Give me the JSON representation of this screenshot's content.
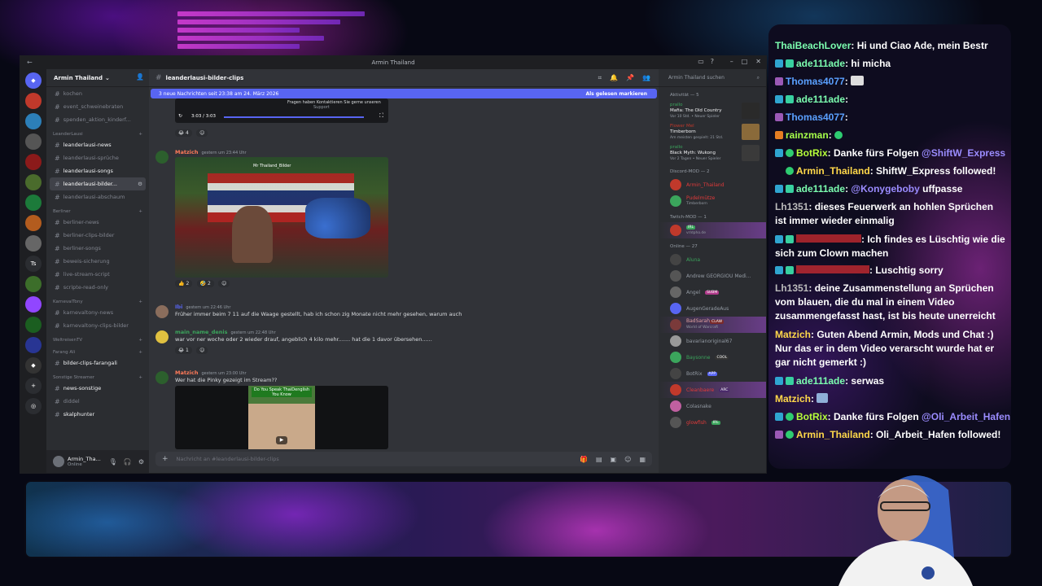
{
  "window": {
    "title": "Armin Thailand"
  },
  "server": {
    "name": "Armin Thailand"
  },
  "channels": {
    "top": [
      "kochen",
      "event_schweinebraten",
      "spenden_aktion_kinderf..."
    ],
    "cat_leander": "LeanderLausi",
    "leander": [
      "leanderlausi-news",
      "leanderlausi-sprüche",
      "leanderlausi-songs",
      "leanderlausi-bilder...",
      "leanderlausi-abschaum"
    ],
    "cat_berliner": "Berliner",
    "berliner": [
      "berliner-news",
      "berliner-clips-bilder",
      "berliner-songs",
      "beweis-sicherung",
      "live-stream-script",
      "scripte-read-only"
    ],
    "cat_karneval": "KarnevalTony",
    "karneval": [
      "karnevaltony-news",
      "karnevaltony-clips-bilder"
    ],
    "cat_weltreisen": "WeltreisenTV",
    "cat_farang": "Farang Ali",
    "farang": [
      "bilder-clips-farangali"
    ],
    "cat_sonstige": "Sonstige Streamer",
    "sonstige": [
      "news-sonstige",
      "diddel",
      "skalphunter"
    ]
  },
  "user": {
    "name": "Armin_Tha...",
    "status": "Online"
  },
  "channel_header": {
    "name": "leanderlausi-bilder-clips"
  },
  "new_messages_bar": {
    "text": "3 neue Nachrichten seit 23:38 am 24. März 2026",
    "action": "Als gelesen markieren"
  },
  "video_player": {
    "time": "3:03 / 3:03",
    "caption1": "Fragen haben Kontaktieren Sie gerne unseren",
    "caption2": "Support"
  },
  "messages": [
    {
      "author": "Matzich",
      "time": "gestern um 23:44 Uhr",
      "text": "",
      "reactions": [
        "2",
        "2"
      ],
      "video_label": "Mr Thailand_Bilder"
    },
    {
      "author": "Ibi",
      "time": "gestern um 22:46 Uhr",
      "text": "Früher immer beim 7 11 auf die Waage gestellt, hab ich schon zig Monate nicht mehr gesehen, warum auch"
    },
    {
      "author": "main_name_denis",
      "time": "gestern um 22:48 Uhr",
      "text": "war vor ner woche oder 2 wieder drauf, angeblich 4 kilo mehr....... hat die 1 davor übersehen......",
      "reactions": [
        "1"
      ]
    },
    {
      "author": "Matzich",
      "time": "gestern um 23:00 Uhr",
      "text": "Wer hat die Pinky gezeigt im Stream??",
      "video_label": "Do You Speak ThaiDenglish You Know"
    }
  ],
  "top_reaction_count": "4",
  "composer": {
    "placeholder": "Nachricht an #leanderlausi-bilder-clips"
  },
  "members": {
    "search": "Armin Thailand suchen",
    "activity_header": "Aktivität — 5",
    "activities": [
      {
        "user": "prallo",
        "game": "Mafia: The Old Country",
        "meta": "Vor 10 Std. • Neuer Spieler"
      },
      {
        "user": "Flower Mel",
        "game": "Timberborn",
        "meta": "Am meisten gespielt: 21 Std."
      },
      {
        "user": "prallo",
        "game": "Black Myth: Wukong",
        "meta": "Vor 2 Tagen • Neuer Spieler"
      }
    ],
    "discord_mod_header": "Discord-MOD — 2",
    "discord_mods": [
      {
        "name": "Armin_Thailand",
        "sub": ""
      },
      {
        "name": "Pudelmütze",
        "sub": "Timberborn"
      }
    ],
    "twitch_mod_header": "Twitch-MOD — 1",
    "twitch_mods": [
      {
        "name": "",
        "sub": "vrldpho.de"
      }
    ],
    "online_header": "Online — 27",
    "online": [
      {
        "name": "Aluna",
        "badge": ""
      },
      {
        "name": "Andrew GEORGIOU Medi...",
        "badge": ""
      },
      {
        "name": "Angel",
        "badge": "SUBM"
      },
      {
        "name": "AugenGeradeAus",
        "badge": ""
      },
      {
        "name": "BadSarah",
        "badge": "CLAW",
        "sub": "World of Warcraft"
      },
      {
        "name": "bavarianoriginal67",
        "badge": ""
      },
      {
        "name": "Baysonne",
        "badge": "COOL"
      },
      {
        "name": "BotRix",
        "badge": "APP"
      },
      {
        "name": "Cleanbaere",
        "badge": "ARC"
      },
      {
        "name": "Colasnake",
        "badge": ""
      },
      {
        "name": "glowfish",
        "badge": "IRL"
      }
    ]
  },
  "chat": [
    {
      "user": "ThaiBeachLover",
      "msg": ": Hi und Ciao Ade, mein Bestr",
      "ucolor": "#7cffb0"
    },
    {
      "user": "ade111ade",
      "msg": ": hi micha",
      "ucolor": "#7cffb0"
    },
    {
      "user": "Thomas4077",
      "msg": ":",
      "ucolor": "#5aa0ff"
    },
    {
      "user": "ade111ade",
      "msg": ":",
      "ucolor": "#7cffb0"
    },
    {
      "user": "Thomas4077",
      "msg": ":",
      "ucolor": "#5aa0ff"
    },
    {
      "user": "rainzman",
      "msg": ":",
      "ucolor": "#a6ff4a"
    },
    {
      "user": "BotRix",
      "msg": ": Danke fürs Folgen ",
      "ucolor": "#b6ff3a",
      "mention": "@ShiftW_Express"
    },
    {
      "user": "Armin_Thailand",
      "msg": ": ShiftW_Express followed!",
      "ucolor": "#ffd84a"
    },
    {
      "user": "ade111ade",
      "msg": ": ",
      "ucolor": "#7cffb0",
      "mention": "@Konygeboby",
      "after": " uffpasse"
    },
    {
      "user": "Lh1351",
      "msg": ": dieses Feuerwerk an hohlen Sprüchen ist immer wieder einmalig",
      "ucolor": "#bbbbbb"
    },
    {
      "user": "",
      "msg": ": Ich findes es Lüschtig wie die sich zum Clown machen",
      "ucolor": "#ff3333"
    },
    {
      "user": "",
      "msg": ": Luschtig sorry",
      "ucolor": "#ff3333"
    },
    {
      "user": "Lh1351",
      "msg": ": deine Zusammenstellung an Sprüchen vom blauen, die du mal in einem Video zusammengefasst hast, ist bis heute unerreicht",
      "ucolor": "#bbbbbb"
    },
    {
      "user": "Matzich",
      "msg": ": Guten Abend Armin, Mods und Chat :) Nur das er in dem Video verarscht wurde hat er gar nicht gemerkt :)",
      "ucolor": "#ffd84a"
    },
    {
      "user": "ade111ade",
      "msg": ": serwas",
      "ucolor": "#7cffb0"
    },
    {
      "user": "Matzich",
      "msg": ":",
      "ucolor": "#ffd84a"
    },
    {
      "user": "BotRix",
      "msg": ": Danke fürs Folgen ",
      "ucolor": "#b6ff3a",
      "mention": "@Oli_Arbeit_Hafen"
    },
    {
      "user": "Armin_Thailand",
      "msg": ": Oli_Arbeit_Hafen followed!",
      "ucolor": "#ffd84a"
    }
  ],
  "colors": {
    "discord_bg": "#313338",
    "accent": "#5865f2",
    "chat_mention": "#9b8cff"
  }
}
